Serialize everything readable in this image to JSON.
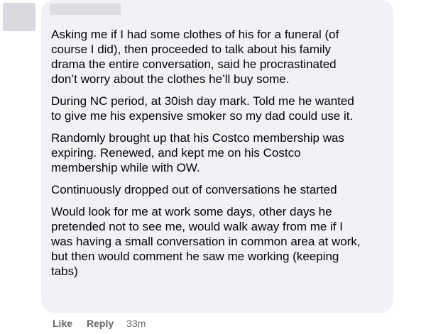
{
  "comment": {
    "paragraphs": [
      "Asking me if I had some clothes of his for a funeral (of\ncourse I did), then proceeded to talk about his family\ndrama the entire conversation, said he procrastinated\ndon’t worry about the clothes he’ll buy some.",
      "During NC period, at 30ish day mark. Told me he wanted\nto give me his expensive smoker so my dad could use it.",
      "Randomly brought up that his Costco membership was\nexpiring. Renewed, and kept me on his Costco\nmembership while with OW.",
      "Continuously dropped out of conversations he started",
      "Would look for me at work some days, other days he\npretended not to see me, would walk away from me if I\nwas having a small conversation in common area at work,\nbut then would comment he saw me working (keeping\ntabs)"
    ]
  },
  "actions": {
    "like_label": "Like",
    "reply_label": "Reply",
    "timestamp": "33m"
  },
  "colors": {
    "bubble_bg": "#f0f2f5",
    "text": "#050505",
    "secondary_text": "#65676b",
    "blurred_placeholder": "#d8dadf"
  }
}
